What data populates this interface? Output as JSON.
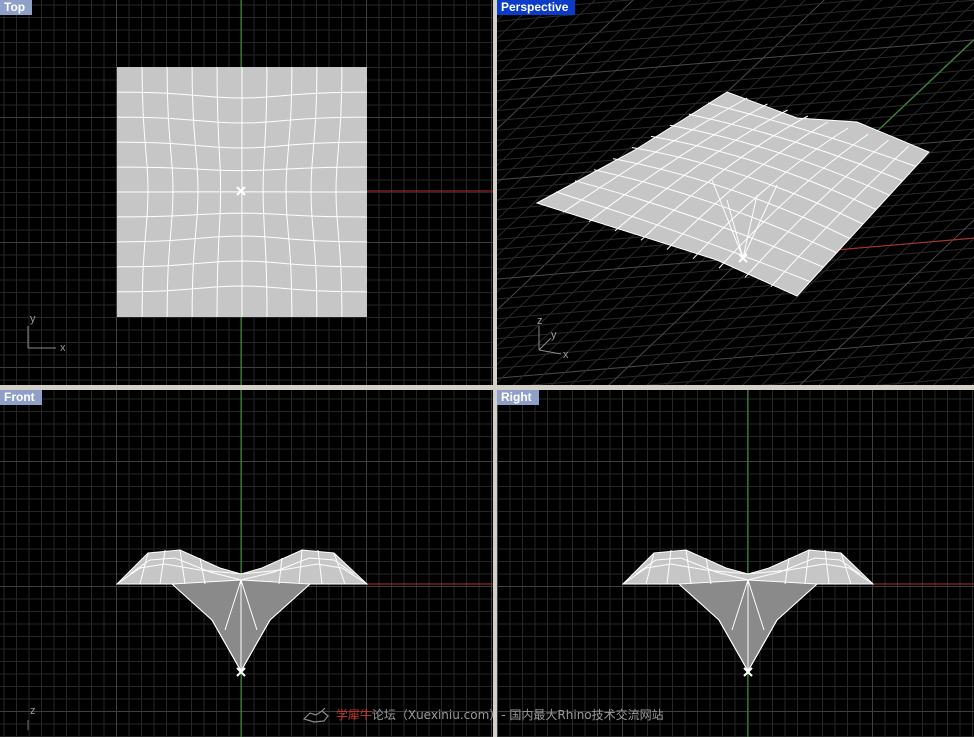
{
  "viewports": {
    "top": {
      "label": "Top",
      "axes": {
        "x": "x",
        "y": "y"
      }
    },
    "perspective": {
      "label": "Perspective",
      "axes": {
        "x": "x",
        "y": "y",
        "z": "z"
      }
    },
    "front": {
      "label": "Front",
      "axes": {
        "z": "z"
      }
    },
    "right": {
      "label": "Right"
    }
  },
  "colors": {
    "viewport_bg": "#000000",
    "frame": "#d4d0c8",
    "label_active": "#0a3cc8",
    "label_inactive": "#8fa0c8",
    "x_axis": "#b43232",
    "y_axis": "#329632",
    "surface_fill": "#c6c6c6",
    "mesh_lines": "#ffffff"
  },
  "watermark": {
    "brand": "学犀牛",
    "text": "论坛（Xuexiniu.com）- 国内最大Rhino技术交流网站"
  }
}
